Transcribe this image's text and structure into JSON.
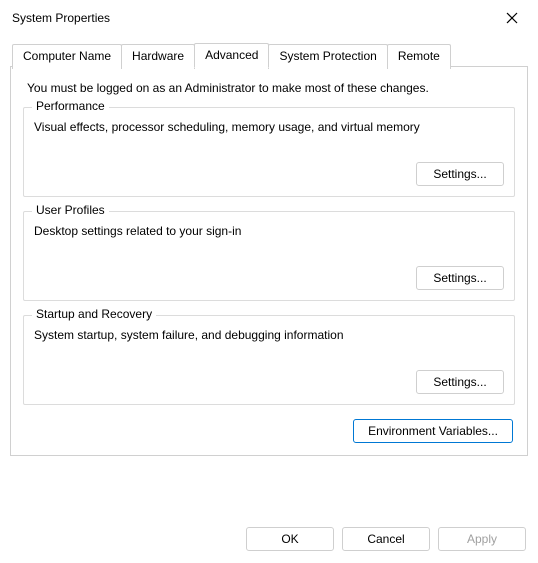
{
  "window": {
    "title": "System Properties"
  },
  "tabs": {
    "computer_name": "Computer Name",
    "hardware": "Hardware",
    "advanced": "Advanced",
    "system_protection": "System Protection",
    "remote": "Remote"
  },
  "advanced_panel": {
    "intro": "You must be logged on as an Administrator to make most of these changes.",
    "performance": {
      "legend": "Performance",
      "desc": "Visual effects, processor scheduling, memory usage, and virtual memory",
      "button": "Settings..."
    },
    "user_profiles": {
      "legend": "User Profiles",
      "desc": "Desktop settings related to your sign-in",
      "button": "Settings..."
    },
    "startup_recovery": {
      "legend": "Startup and Recovery",
      "desc": "System startup, system failure, and debugging information",
      "button": "Settings..."
    },
    "env_vars_button": "Environment Variables..."
  },
  "footer": {
    "ok": "OK",
    "cancel": "Cancel",
    "apply": "Apply"
  }
}
